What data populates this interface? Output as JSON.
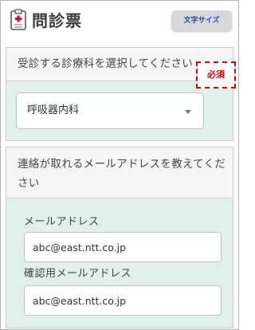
{
  "header": {
    "title": "問診票",
    "font_size_button": "文字サイズ",
    "icon": "clipboard-icon"
  },
  "department_section": {
    "question": "受診する診療科を選択してください",
    "required_badge": "必須",
    "select": {
      "value": "呼吸器内科",
      "icon": "chevron-down-icon"
    }
  },
  "email_section": {
    "question": "連絡が取れるメールアドレスを教えてください",
    "email_label": "メールアドレス",
    "email_value": "abc@east.ntt.co.jp",
    "confirm_label": "確認用メールアドレス",
    "confirm_value": "abc@east.ntt.co.jp"
  },
  "colors": {
    "section_bg": "#dff1e9",
    "required_red": "#e10000",
    "button_text_blue": "#1a4fc4"
  }
}
